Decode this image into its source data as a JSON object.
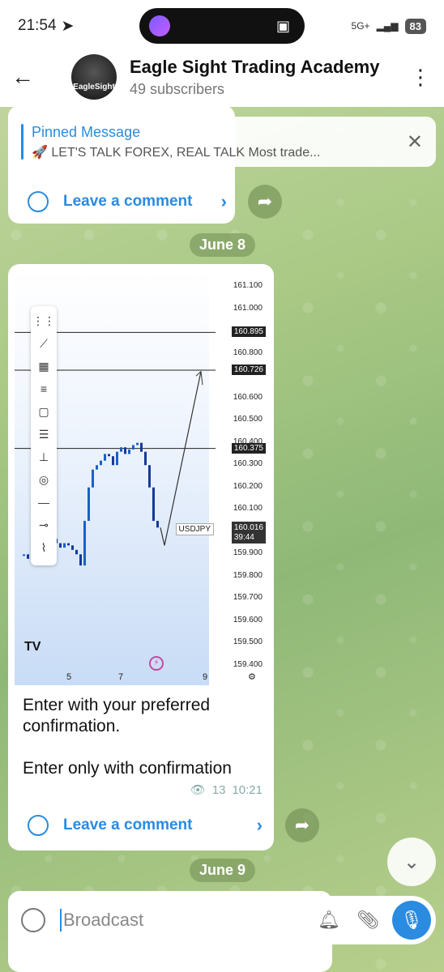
{
  "status": {
    "time": "21:54",
    "network": "5G+",
    "battery": "83"
  },
  "header": {
    "title": "Eagle Sight Trading Academy",
    "subtitle": "49 subscribers",
    "avatar_text": "EagleSight"
  },
  "pinned": {
    "title": "Pinned Message",
    "text": "🚀 LET'S TALK FOREX, REAL TALK  Most trade..."
  },
  "post1": {
    "comment_label": "Leave a comment"
  },
  "date1": "June 8",
  "chart": {
    "symbol": "USDJPY",
    "price": "160.016",
    "countdown": "39:44",
    "ticks": [
      "161.100",
      "161.000",
      "160.895",
      "160.800",
      "160.726",
      "160.600",
      "160.500",
      "160.400",
      "160.375",
      "160.300",
      "160.200",
      "160.100",
      "159.900",
      "159.800",
      "159.700",
      "159.600",
      "159.500",
      "159.400"
    ],
    "hlines": [
      "160.895",
      "160.726",
      "160.375"
    ],
    "x_labels": [
      "5",
      "7",
      "9"
    ]
  },
  "chart_data": {
    "type": "line",
    "title": "",
    "xlabel": "",
    "ylabel": "",
    "ylim": [
      159.4,
      161.1
    ],
    "x": [
      "5",
      "7",
      "9"
    ],
    "series": [
      {
        "values": [
          159.9,
          160.4,
          160.016
        ]
      }
    ]
  },
  "post2": {
    "line1": "Enter with your preferred",
    "line2": "confirmation.",
    "line3": "Enter only with confirmation",
    "views": "13",
    "time": "10:21",
    "comment_label": "Leave a comment"
  },
  "date2": "June 9",
  "input": {
    "placeholder": "Broadcast"
  }
}
